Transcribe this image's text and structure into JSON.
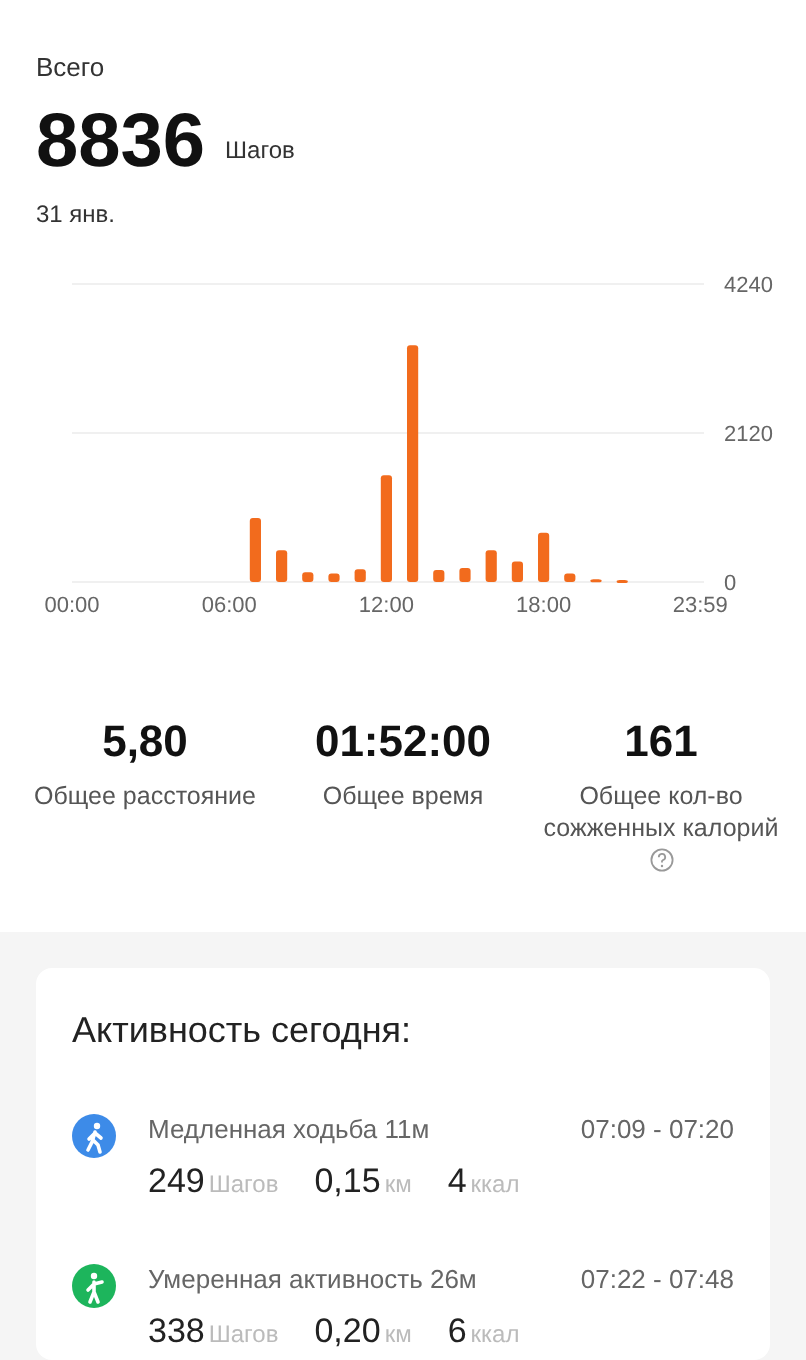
{
  "summary": {
    "label": "Всего",
    "steps": "8836",
    "unit": "Шагов",
    "date": "31 янв."
  },
  "chart": {
    "chart_data": {
      "type": "bar",
      "x": [
        7,
        8,
        9,
        10,
        11,
        12,
        13,
        14,
        15,
        16,
        17,
        18,
        19,
        20,
        21
      ],
      "series": [
        {
          "color": "#f26b1d",
          "values": [
            910,
            450,
            140,
            120,
            180,
            1520,
            3370,
            170,
            200,
            450,
            290,
            700,
            120,
            40,
            30
          ]
        }
      ],
      "xlim": [
        0,
        24
      ],
      "ylim": [
        0,
        4240
      ],
      "xticks": [
        {
          "value": 0,
          "label": "00:00"
        },
        {
          "value": 6,
          "label": "06:00"
        },
        {
          "value": 12,
          "label": "12:00"
        },
        {
          "value": 18,
          "label": "18:00"
        },
        {
          "value": 23.98,
          "label": "23:59"
        }
      ],
      "yticks": [
        0,
        2120,
        4240
      ]
    }
  },
  "stats": [
    {
      "value": "5,80",
      "label": "Общее расстояние",
      "help": false
    },
    {
      "value": "01:52:00",
      "label": "Общее время",
      "help": false
    },
    {
      "value": "161",
      "label": "Общее кол-во сожженных калорий",
      "help": true
    }
  ],
  "activity": {
    "title": "Активность сегодня:",
    "items": [
      {
        "kind": "walk",
        "color": "#3d8be8",
        "name": "Медленная ходьба 11м",
        "time": "07:09 - 07:20",
        "steps": "249",
        "steps_unit": "Шагов",
        "distance": "0,15",
        "distance_unit": "км",
        "calories": "4",
        "calories_unit": "ккал"
      },
      {
        "kind": "moderate",
        "color": "#1db55c",
        "name": "Умеренная активность 26м",
        "time": "07:22 - 07:48",
        "steps": "338",
        "steps_unit": "Шагов",
        "distance": "0,20",
        "distance_unit": "км",
        "calories": "6",
        "calories_unit": "ккал"
      }
    ]
  }
}
